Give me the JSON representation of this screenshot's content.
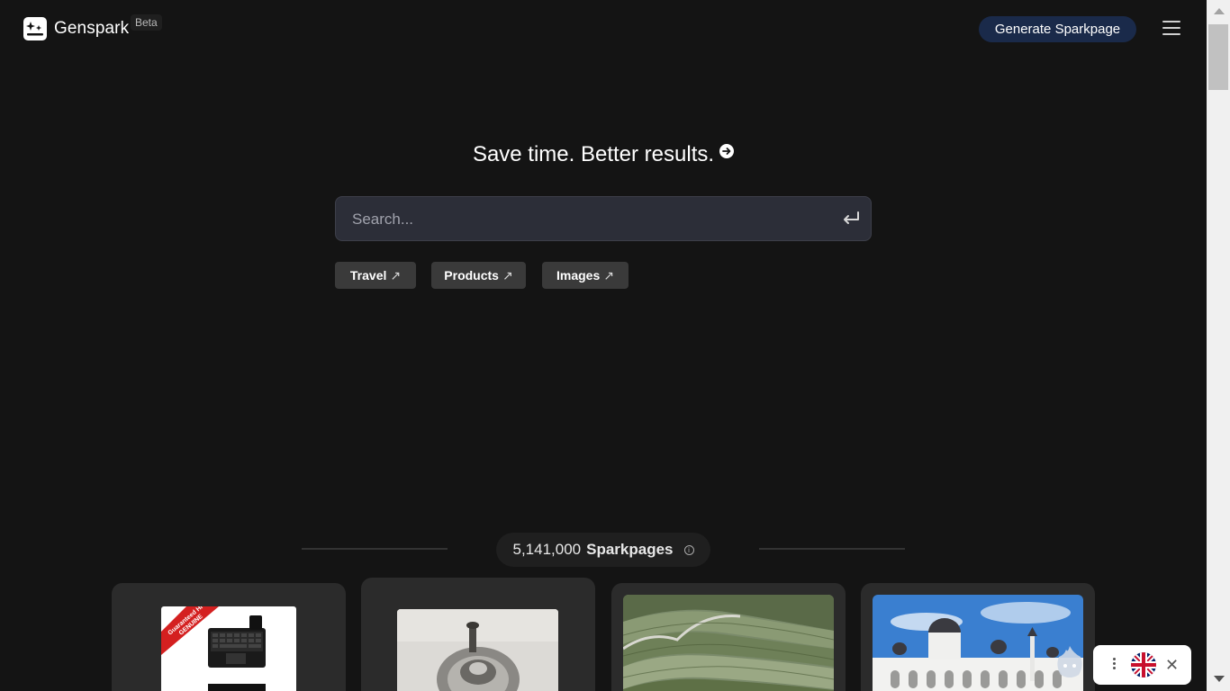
{
  "header": {
    "brand": "Genspark",
    "badge": "Beta",
    "generate_button": "Generate Sparkpage"
  },
  "hero": {
    "title": "Save time. Better results."
  },
  "search": {
    "placeholder": "Search..."
  },
  "chips": [
    {
      "label": "Travel",
      "arrow": "↗"
    },
    {
      "label": "Products",
      "arrow": "↗"
    },
    {
      "label": "Images",
      "arrow": "↗"
    }
  ],
  "counter": {
    "value": "5,141,000",
    "label": "Sparkpages",
    "info": "i"
  },
  "product_badge": "Guaranteed HP GENUINE",
  "widget": {
    "close": "✕"
  },
  "colors": {
    "background": "#141414",
    "accent_button": "#1a2a4a",
    "search_bg": "#2c2e38",
    "chip_bg": "#3a3a3a",
    "card_bg": "#2b2b2b"
  }
}
